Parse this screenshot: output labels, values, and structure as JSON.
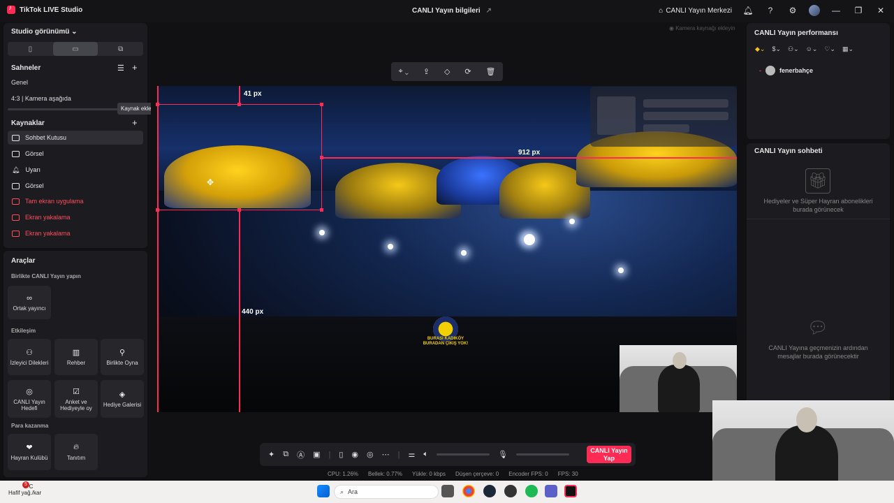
{
  "app": {
    "title": "TikTok LIVE Studio",
    "center_title": "CANLI Yayın bilgileri",
    "center_link": "CANLI Yayın Merkezi"
  },
  "left": {
    "view_label": "Studio görünümü",
    "scenes_label": "Sahneler",
    "scenes": [
      "Genel",
      "4:3 | Kamera aşağıda"
    ],
    "tooltip": "Kaynak ekle",
    "sources_label": "Kaynaklar",
    "sources": [
      {
        "label": "Sohbet Kutusu",
        "state": "selected"
      },
      {
        "label": "Görsel",
        "state": "normal"
      },
      {
        "label": "Uyarı",
        "state": "normal"
      },
      {
        "label": "Görsel",
        "state": "normal"
      },
      {
        "label": "Tam ekran uygulama",
        "state": "error"
      },
      {
        "label": "Ekran yakalama",
        "state": "error"
      },
      {
        "label": "Ekran yakalama",
        "state": "error"
      }
    ],
    "tools_label": "Araçlar",
    "collab_label": "Birlikte CANLI Yayın yapın",
    "collab_tool": "Ortak yayıncı",
    "interaction_label": "Etkileşim",
    "interaction_tools": [
      "İzleyici Dilekleri",
      "Rehber",
      "Birlikte Oyna",
      "CANLI Yayın Hedefi",
      "Anket ve Hediyeyle oy",
      "Hediye Galerisi"
    ],
    "earn_label": "Para kazanma",
    "earn_tools": [
      "Hayran Kulübü",
      "Tanıtım"
    ]
  },
  "canvas": {
    "hint": "Kamera kaynağı ekleyin",
    "measure_top": "41 px",
    "measure_right": "912 px",
    "measure_left": "440 px",
    "badge_text": "BURASI KADIKÖY BURADAN ÇIKIŞ YOK!"
  },
  "bottom": {
    "go_live": "CANLI Yayın Yap",
    "stats": [
      "CPU: 1.26%",
      "Bellek: 0.77%",
      "Yükle: 0 kbps",
      "Düşen çerçeve: 0",
      "Encoder FPS: 0",
      "FPS: 30"
    ]
  },
  "right": {
    "perf_title": "CANLI Yayın performansı",
    "viewer": "fenerbahçe",
    "chat_title": "CANLI Yayın sohbeti",
    "gifts_empty": "Hediyeler ve Süper Hayran abonelikleri burada görünecek",
    "chat_empty": "CANLI Yayına geçmenizin ardından mesajlar burada görünecektir"
  },
  "taskbar": {
    "temp": "3°C",
    "weather": "Hafif yağ./kar",
    "badge": "5",
    "search": "Ara"
  },
  "colors": {
    "accent": "#fe2c55",
    "bg": "#111114",
    "panel": "#1c1c20"
  }
}
